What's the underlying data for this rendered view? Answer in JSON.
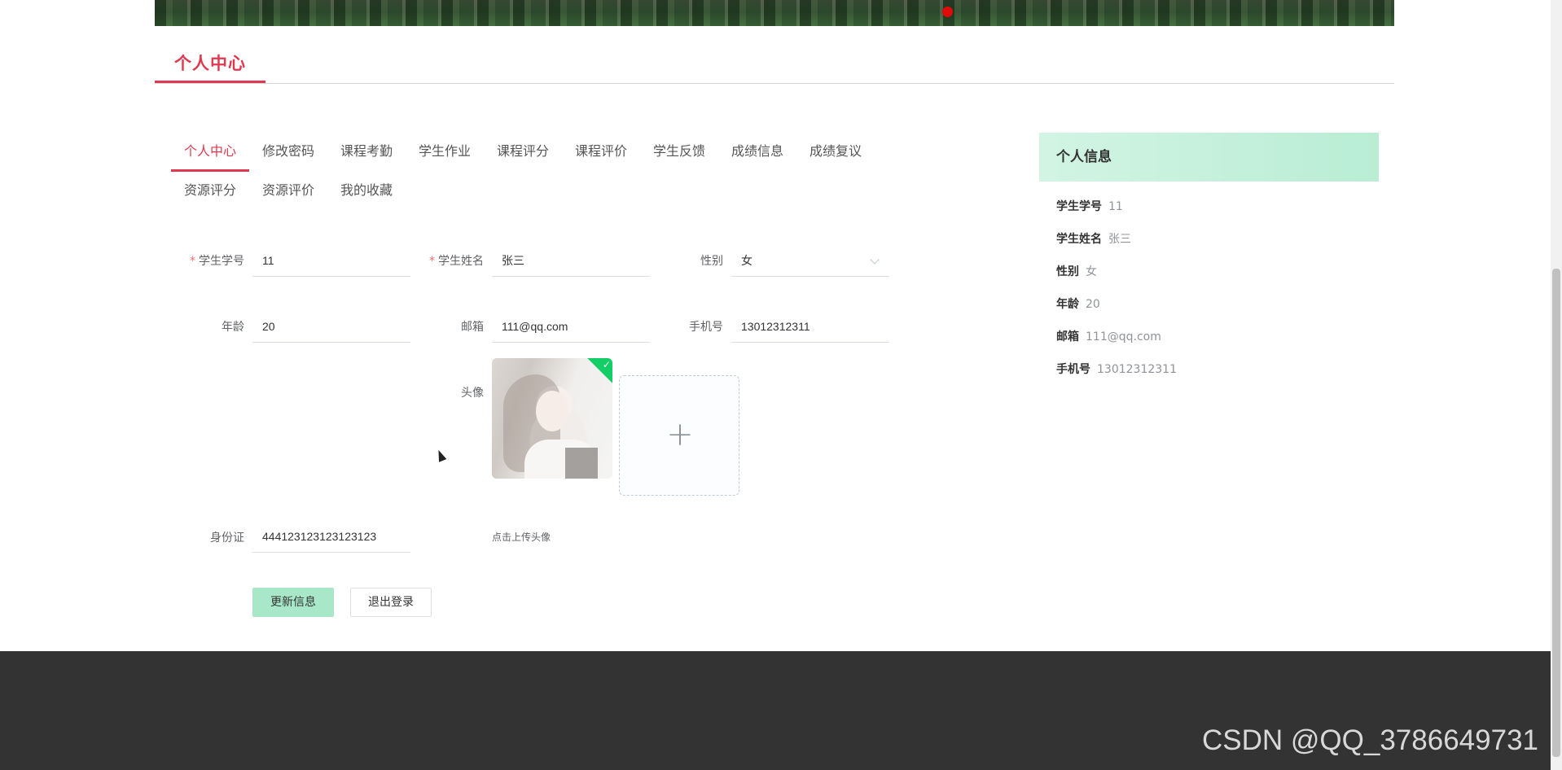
{
  "section": {
    "title": "个人中心"
  },
  "tabs": [
    {
      "label": "个人中心",
      "active": true
    },
    {
      "label": "修改密码"
    },
    {
      "label": "课程考勤"
    },
    {
      "label": "学生作业"
    },
    {
      "label": "课程评分"
    },
    {
      "label": "课程评价"
    },
    {
      "label": "学生反馈"
    },
    {
      "label": "成绩信息"
    },
    {
      "label": "成绩复议"
    },
    {
      "label": "资源评分"
    },
    {
      "label": "资源评价"
    },
    {
      "label": "我的收藏"
    }
  ],
  "form": {
    "student_no": {
      "label": "学生学号",
      "required": "*",
      "value": "11"
    },
    "student_name": {
      "label": "学生姓名",
      "required": "*",
      "value": "张三"
    },
    "gender": {
      "label": "性别",
      "value": "女"
    },
    "age": {
      "label": "年龄",
      "value": "20"
    },
    "email": {
      "label": "邮箱",
      "value": "111@qq.com"
    },
    "phone": {
      "label": "手机号",
      "value": "13012312311"
    },
    "avatar": {
      "label": "头像",
      "upload_tip": "点击上传头像"
    },
    "id_card": {
      "label": "身份证",
      "value": "444123123123123123"
    },
    "buttons": {
      "update": "更新信息",
      "logout": "退出登录"
    }
  },
  "info_panel": {
    "title": "个人信息",
    "rows": [
      {
        "key": "学生学号",
        "value": "11"
      },
      {
        "key": "学生姓名",
        "value": "张三"
      },
      {
        "key": "性别",
        "value": "女"
      },
      {
        "key": "年龄",
        "value": "20"
      },
      {
        "key": "邮箱",
        "value": "111@qq.com"
      },
      {
        "key": "手机号",
        "value": "13012312311"
      }
    ]
  },
  "watermark": "CSDN @QQ_3786649731",
  "colors": {
    "accent": "#e0384e",
    "panel_head": "#c4f0da",
    "primary_button": "#a8e8c8",
    "footer": "#333333"
  }
}
